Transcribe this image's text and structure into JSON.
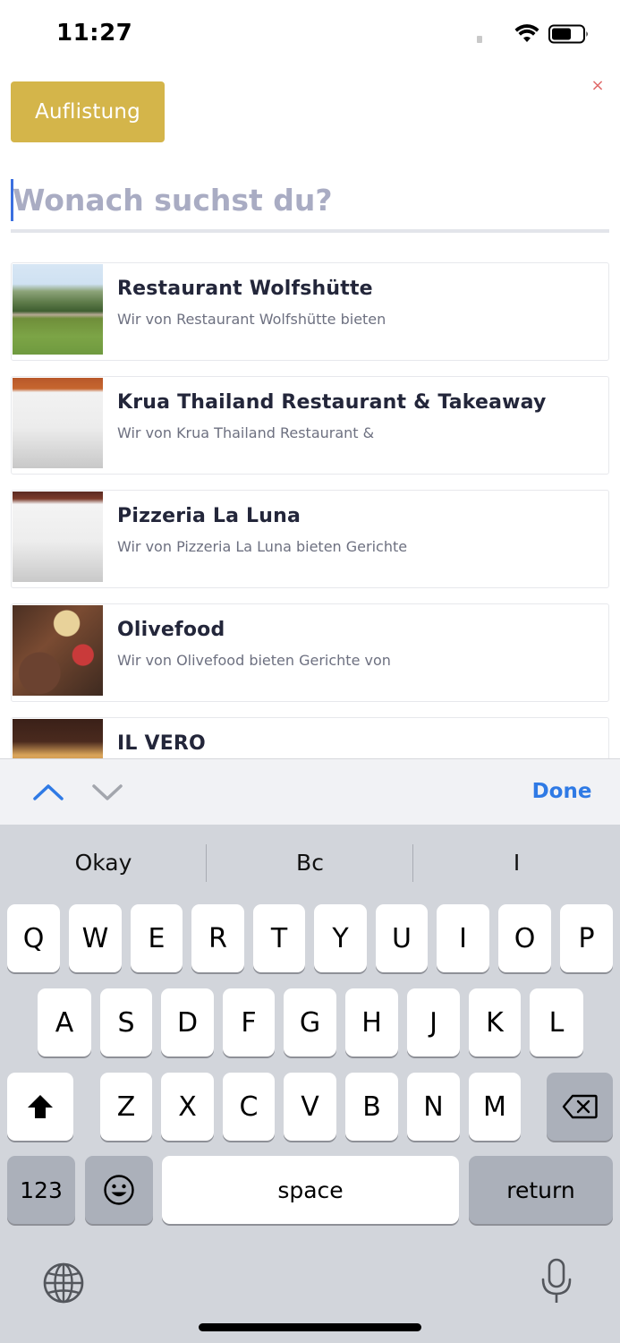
{
  "status_bar": {
    "time": "11:27",
    "icons": [
      "signal-icon",
      "wifi-icon",
      "battery-icon"
    ]
  },
  "header": {
    "listing_button": "Auflistung",
    "close_symbol": "×"
  },
  "search": {
    "placeholder": "Wonach suchst du?",
    "value": ""
  },
  "listings": [
    {
      "title": "Restaurant Wolfshütte",
      "description": "Wir von Restaurant Wolfshütte bieten",
      "image": "mountain-landscape"
    },
    {
      "title": "Krua Thailand Restaurant & Takeaway",
      "description": "Wir von Krua Thailand Restaurant &",
      "image": "restaurant-photo"
    },
    {
      "title": "Pizzeria La Luna",
      "description": "Wir von Pizzeria La Luna bieten Gerichte",
      "image": "restaurant-photo"
    },
    {
      "title": "Olivefood",
      "description": "Wir von Olivefood bieten Gerichte von",
      "image": "food-platter"
    },
    {
      "title": "IL VERO",
      "description": "",
      "image": "pizza"
    }
  ],
  "accessory_bar": {
    "done_label": "Done",
    "icons": [
      "chevron-up-icon",
      "chevron-down-icon"
    ]
  },
  "keyboard": {
    "suggestions": [
      "Okay",
      "Bc",
      "I"
    ],
    "row1": [
      "Q",
      "W",
      "E",
      "R",
      "T",
      "Y",
      "U",
      "I",
      "O",
      "P"
    ],
    "row2": [
      "A",
      "S",
      "D",
      "F",
      "G",
      "H",
      "J",
      "K",
      "L"
    ],
    "row3": [
      "Z",
      "X",
      "C",
      "V",
      "B",
      "N",
      "M"
    ],
    "numbers_key": "123",
    "space_key": "space",
    "return_key": "return",
    "icons": [
      "shift-icon",
      "backspace-icon",
      "emoji-icon",
      "globe-icon",
      "microphone-icon"
    ]
  },
  "colors": {
    "accent": "#d4b54a",
    "link_blue": "#2f7ae5",
    "close_red": "#e06a6a",
    "keyboard_bg": "#d2d5db"
  }
}
